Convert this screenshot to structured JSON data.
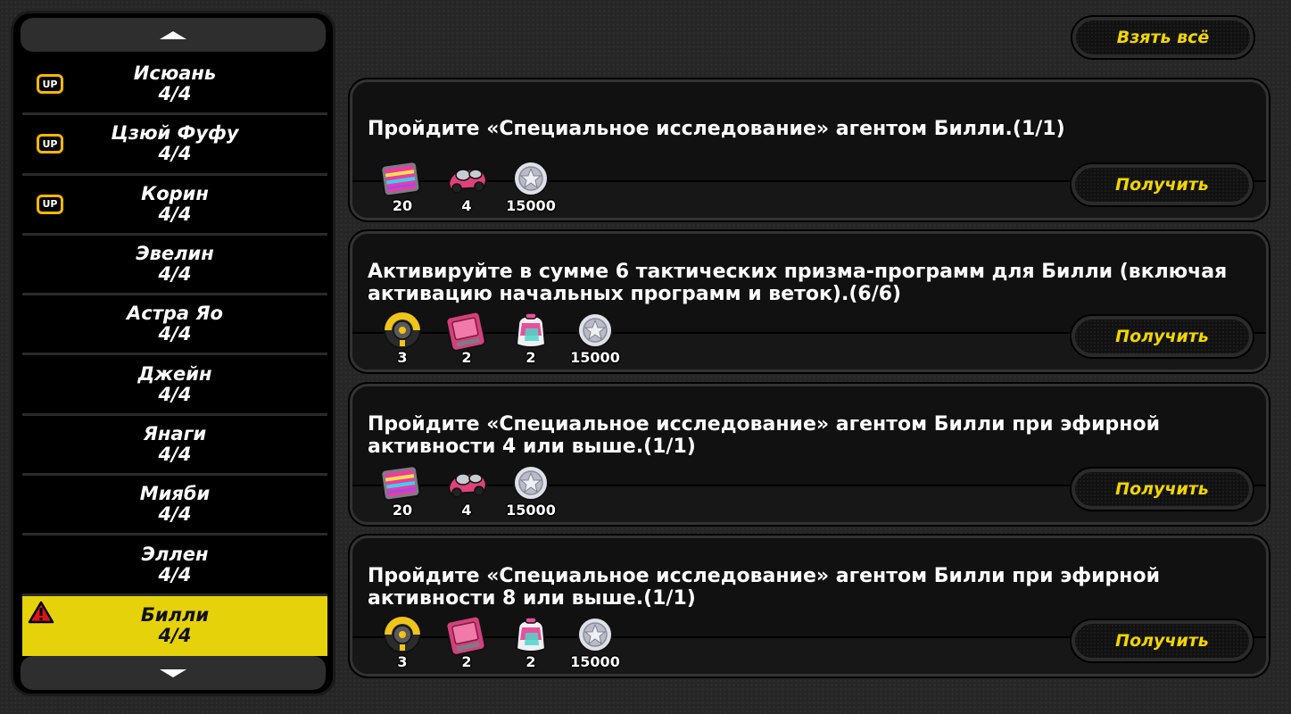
{
  "sidebar": {
    "agents": [
      {
        "name": "Исюань",
        "count": "4/4",
        "badge": "UP"
      },
      {
        "name": "Цзюй Фуфу",
        "count": "4/4",
        "badge": "UP"
      },
      {
        "name": "Корин",
        "count": "4/4",
        "badge": "UP"
      },
      {
        "name": "Эвелин",
        "count": "4/4"
      },
      {
        "name": "Астра Яо",
        "count": "4/4"
      },
      {
        "name": "Джейн",
        "count": "4/4"
      },
      {
        "name": "Янаги",
        "count": "4/4"
      },
      {
        "name": "Мияби",
        "count": "4/4"
      },
      {
        "name": "Эллен",
        "count": "4/4"
      },
      {
        "name": "Билли",
        "count": "4/4",
        "active": true,
        "alert": true
      }
    ]
  },
  "header": {
    "claim_all_label": "Взять всё"
  },
  "tasks": [
    {
      "text": "Пройдите «Специальное исследование» агентом Билли.(1/1)",
      "rewards": [
        {
          "icon": "film-reel-icon",
          "count": "20"
        },
        {
          "icon": "car-icon",
          "count": "4"
        },
        {
          "icon": "dennies-coin-icon",
          "count": "15000"
        }
      ],
      "button_label": "Получить"
    },
    {
      "text": "Активируйте в сумме 6 тактических призма-программ для Билли (включая активацию начальных программ и веток).(6/6)",
      "rewards": [
        {
          "icon": "gold-chip-icon",
          "count": "3"
        },
        {
          "icon": "data-card-icon",
          "count": "2"
        },
        {
          "icon": "backpack-icon",
          "count": "2"
        },
        {
          "icon": "dennies-coin-icon",
          "count": "15000"
        }
      ],
      "button_label": "Получить"
    },
    {
      "text": "Пройдите «Специальное исследование» агентом Билли при эфирной активности 4 или выше.(1/1)",
      "rewards": [
        {
          "icon": "film-reel-icon",
          "count": "20"
        },
        {
          "icon": "car-icon",
          "count": "4"
        },
        {
          "icon": "dennies-coin-icon",
          "count": "15000"
        }
      ],
      "button_label": "Получить"
    },
    {
      "text": "Пройдите «Специальное исследование» агентом Билли при эфирной активности 8 или выше.(1/1)",
      "rewards": [
        {
          "icon": "gold-chip-icon",
          "count": "3"
        },
        {
          "icon": "data-card-icon",
          "count": "2"
        },
        {
          "icon": "backpack-icon",
          "count": "2"
        },
        {
          "icon": "dennies-coin-icon",
          "count": "15000"
        }
      ],
      "button_label": "Получить"
    }
  ]
}
